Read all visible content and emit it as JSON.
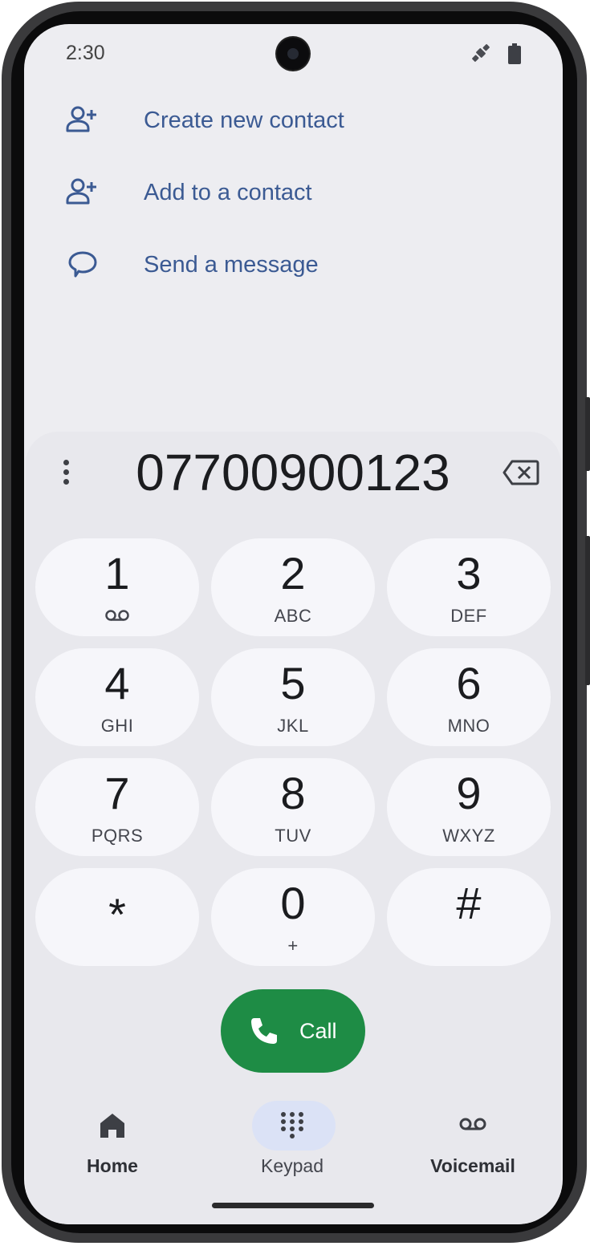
{
  "status_bar": {
    "time": "2:30"
  },
  "actions": [
    {
      "label": "Create new contact",
      "icon": "person-add-icon"
    },
    {
      "label": "Add to a contact",
      "icon": "person-add-icon"
    },
    {
      "label": "Send a message",
      "icon": "message-bubble-icon"
    }
  ],
  "dialer": {
    "number": "07700900123",
    "keys": [
      {
        "digit": "1",
        "letters": ""
      },
      {
        "digit": "2",
        "letters": "ABC"
      },
      {
        "digit": "3",
        "letters": "DEF"
      },
      {
        "digit": "4",
        "letters": "GHI"
      },
      {
        "digit": "5",
        "letters": "JKL"
      },
      {
        "digit": "6",
        "letters": "MNO"
      },
      {
        "digit": "7",
        "letters": "PQRS"
      },
      {
        "digit": "8",
        "letters": "TUV"
      },
      {
        "digit": "9",
        "letters": "WXYZ"
      },
      {
        "digit": "*",
        "letters": ""
      },
      {
        "digit": "0",
        "letters": "+"
      },
      {
        "digit": "#",
        "letters": ""
      }
    ],
    "call_label": "Call"
  },
  "nav": {
    "home": "Home",
    "keypad": "Keypad",
    "voicemail": "Voicemail",
    "active": "keypad"
  },
  "colors": {
    "accent_text": "#3b5a93",
    "call_green": "#1e8c45",
    "nav_active_pill": "#dbe2f6"
  }
}
